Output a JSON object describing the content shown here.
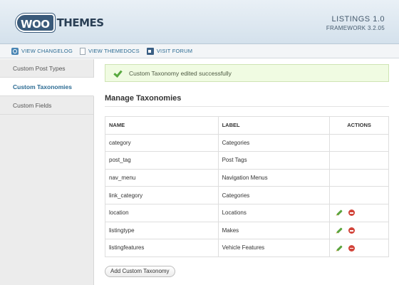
{
  "header": {
    "logo_left": "WOO",
    "logo_right": "THEMES",
    "product_name": "LISTINGS 1.0",
    "framework": "FRAMEWORK 3.2.05"
  },
  "links": [
    {
      "label": "VIEW CHANGELOG",
      "icon": "search-icon"
    },
    {
      "label": "VIEW THEMEDOCS",
      "icon": "document-icon"
    },
    {
      "label": "VISIT FORUM",
      "icon": "forum-icon"
    }
  ],
  "sidebar": {
    "items": [
      {
        "label": "Custom Post Types",
        "active": false
      },
      {
        "label": "Custom Taxonomies",
        "active": true
      },
      {
        "label": "Custom Fields",
        "active": false
      }
    ]
  },
  "notice": {
    "text": "Custom Taxonomy edited successfully"
  },
  "section_title": "Manage Taxonomies",
  "table": {
    "headers": {
      "name": "NAME",
      "label": "LABEL",
      "actions": "ACTIONS"
    },
    "rows": [
      {
        "name": "category",
        "label": "Categories",
        "actions": false
      },
      {
        "name": "post_tag",
        "label": "Post Tags",
        "actions": false
      },
      {
        "name": "nav_menu",
        "label": "Navigation Menus",
        "actions": false
      },
      {
        "name": "link_category",
        "label": "Categories",
        "actions": false
      },
      {
        "name": "location",
        "label": "Locations",
        "actions": true
      },
      {
        "name": "listingtype",
        "label": "Makes",
        "actions": true
      },
      {
        "name": "listingfeatures",
        "label": "Vehicle Features",
        "actions": true
      }
    ]
  },
  "add_button": "Add Custom Taxonomy",
  "colors": {
    "link": "#2b6b93",
    "success_bg": "#f0fbe2",
    "edit": "#5aa33c",
    "delete": "#d2443a"
  }
}
